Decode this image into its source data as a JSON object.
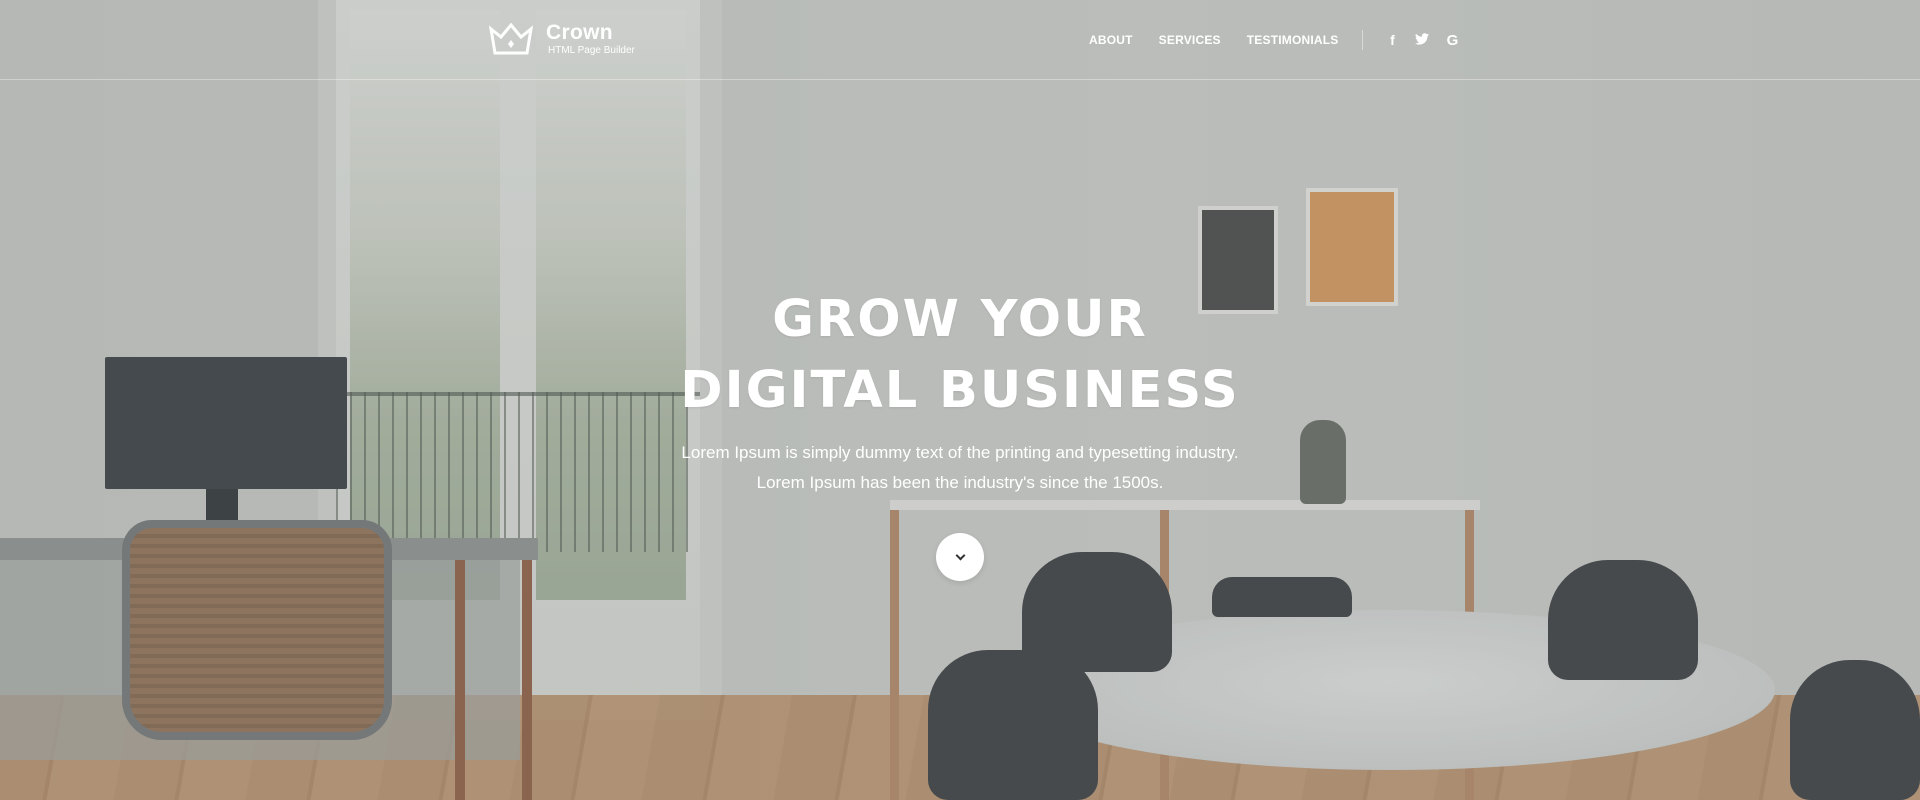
{
  "header": {
    "brand_name": "Crown",
    "brand_tagline": "HTML Page Builder",
    "logo_icon": "crown-icon",
    "nav": [
      {
        "label": "ABOUT"
      },
      {
        "label": "SERVICES"
      },
      {
        "label": "TESTIMONIALS"
      }
    ],
    "social": [
      {
        "icon": "facebook-icon",
        "glyph": "f"
      },
      {
        "icon": "twitter-icon",
        "glyph": "🐦"
      },
      {
        "icon": "google-plus-icon",
        "glyph": "G"
      }
    ]
  },
  "hero": {
    "title_line1": "GROW YOUR",
    "title_line2": "DIGITAL BUSINESS",
    "subtitle_line1": "Lorem Ipsum is simply dummy text of the printing and typesetting industry.",
    "subtitle_line2": "Lorem Ipsum has been the industry's since the 1500s.",
    "scroll_icon": "chevron-down-icon"
  },
  "colors": {
    "text": "#ffffff",
    "overlay": "#8c9191",
    "button_bg": "#ffffff"
  }
}
